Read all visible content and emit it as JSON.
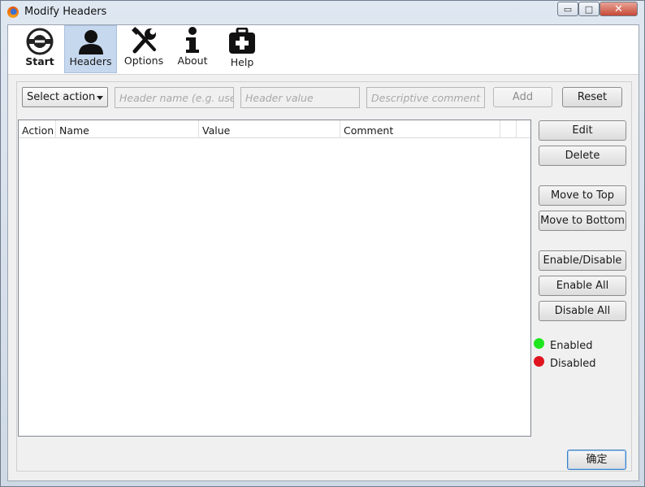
{
  "window": {
    "title": "Modify Headers",
    "controls": {
      "minimize": "▭",
      "maximize": "□",
      "close": "✕"
    }
  },
  "toolbar": {
    "items": [
      {
        "label": "Start",
        "icon": "start-icon",
        "selected": false
      },
      {
        "label": "Headers",
        "icon": "user-icon",
        "selected": true
      },
      {
        "label": "Options",
        "icon": "tools-icon",
        "selected": false
      },
      {
        "label": "About",
        "icon": "info-icon",
        "selected": false
      },
      {
        "label": "Help",
        "icon": "first-aid-icon",
        "selected": false
      }
    ]
  },
  "form": {
    "action_select": "Select action",
    "header_name_placeholder": "Header name (e.g. user-",
    "header_value_placeholder": "Header value",
    "comment_placeholder": "Descriptive comment",
    "add_label": "Add",
    "reset_label": "Reset"
  },
  "table": {
    "columns": [
      "Action",
      "Name",
      "Value",
      "Comment"
    ],
    "rows": []
  },
  "side_buttons": {
    "edit": "Edit",
    "delete": "Delete",
    "move_top": "Move to Top",
    "move_bottom": "Move to Bottom",
    "enable_disable": "Enable/Disable",
    "enable_all": "Enable All",
    "disable_all": "Disable All"
  },
  "legend": {
    "enabled": "Enabled",
    "disabled": "Disabled",
    "enabled_color": "#1ee61e",
    "disabled_color": "#e0141e"
  },
  "footer": {
    "ok_label": "确定"
  }
}
